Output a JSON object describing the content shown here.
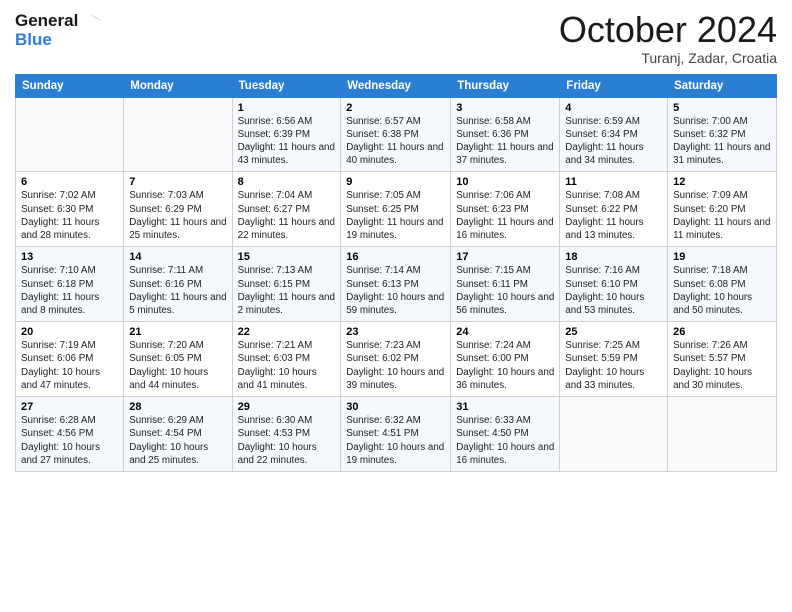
{
  "header": {
    "logo_line1": "General",
    "logo_line2": "Blue",
    "month": "October 2024",
    "location": "Turanj, Zadar, Croatia"
  },
  "days_of_week": [
    "Sunday",
    "Monday",
    "Tuesday",
    "Wednesday",
    "Thursday",
    "Friday",
    "Saturday"
  ],
  "weeks": [
    [
      {
        "day": "",
        "sunrise": "",
        "sunset": "",
        "daylight": ""
      },
      {
        "day": "",
        "sunrise": "",
        "sunset": "",
        "daylight": ""
      },
      {
        "day": "1",
        "sunrise": "Sunrise: 6:56 AM",
        "sunset": "Sunset: 6:39 PM",
        "daylight": "Daylight: 11 hours and 43 minutes."
      },
      {
        "day": "2",
        "sunrise": "Sunrise: 6:57 AM",
        "sunset": "Sunset: 6:38 PM",
        "daylight": "Daylight: 11 hours and 40 minutes."
      },
      {
        "day": "3",
        "sunrise": "Sunrise: 6:58 AM",
        "sunset": "Sunset: 6:36 PM",
        "daylight": "Daylight: 11 hours and 37 minutes."
      },
      {
        "day": "4",
        "sunrise": "Sunrise: 6:59 AM",
        "sunset": "Sunset: 6:34 PM",
        "daylight": "Daylight: 11 hours and 34 minutes."
      },
      {
        "day": "5",
        "sunrise": "Sunrise: 7:00 AM",
        "sunset": "Sunset: 6:32 PM",
        "daylight": "Daylight: 11 hours and 31 minutes."
      }
    ],
    [
      {
        "day": "6",
        "sunrise": "Sunrise: 7:02 AM",
        "sunset": "Sunset: 6:30 PM",
        "daylight": "Daylight: 11 hours and 28 minutes."
      },
      {
        "day": "7",
        "sunrise": "Sunrise: 7:03 AM",
        "sunset": "Sunset: 6:29 PM",
        "daylight": "Daylight: 11 hours and 25 minutes."
      },
      {
        "day": "8",
        "sunrise": "Sunrise: 7:04 AM",
        "sunset": "Sunset: 6:27 PM",
        "daylight": "Daylight: 11 hours and 22 minutes."
      },
      {
        "day": "9",
        "sunrise": "Sunrise: 7:05 AM",
        "sunset": "Sunset: 6:25 PM",
        "daylight": "Daylight: 11 hours and 19 minutes."
      },
      {
        "day": "10",
        "sunrise": "Sunrise: 7:06 AM",
        "sunset": "Sunset: 6:23 PM",
        "daylight": "Daylight: 11 hours and 16 minutes."
      },
      {
        "day": "11",
        "sunrise": "Sunrise: 7:08 AM",
        "sunset": "Sunset: 6:22 PM",
        "daylight": "Daylight: 11 hours and 13 minutes."
      },
      {
        "day": "12",
        "sunrise": "Sunrise: 7:09 AM",
        "sunset": "Sunset: 6:20 PM",
        "daylight": "Daylight: 11 hours and 11 minutes."
      }
    ],
    [
      {
        "day": "13",
        "sunrise": "Sunrise: 7:10 AM",
        "sunset": "Sunset: 6:18 PM",
        "daylight": "Daylight: 11 hours and 8 minutes."
      },
      {
        "day": "14",
        "sunrise": "Sunrise: 7:11 AM",
        "sunset": "Sunset: 6:16 PM",
        "daylight": "Daylight: 11 hours and 5 minutes."
      },
      {
        "day": "15",
        "sunrise": "Sunrise: 7:13 AM",
        "sunset": "Sunset: 6:15 PM",
        "daylight": "Daylight: 11 hours and 2 minutes."
      },
      {
        "day": "16",
        "sunrise": "Sunrise: 7:14 AM",
        "sunset": "Sunset: 6:13 PM",
        "daylight": "Daylight: 10 hours and 59 minutes."
      },
      {
        "day": "17",
        "sunrise": "Sunrise: 7:15 AM",
        "sunset": "Sunset: 6:11 PM",
        "daylight": "Daylight: 10 hours and 56 minutes."
      },
      {
        "day": "18",
        "sunrise": "Sunrise: 7:16 AM",
        "sunset": "Sunset: 6:10 PM",
        "daylight": "Daylight: 10 hours and 53 minutes."
      },
      {
        "day": "19",
        "sunrise": "Sunrise: 7:18 AM",
        "sunset": "Sunset: 6:08 PM",
        "daylight": "Daylight: 10 hours and 50 minutes."
      }
    ],
    [
      {
        "day": "20",
        "sunrise": "Sunrise: 7:19 AM",
        "sunset": "Sunset: 6:06 PM",
        "daylight": "Daylight: 10 hours and 47 minutes."
      },
      {
        "day": "21",
        "sunrise": "Sunrise: 7:20 AM",
        "sunset": "Sunset: 6:05 PM",
        "daylight": "Daylight: 10 hours and 44 minutes."
      },
      {
        "day": "22",
        "sunrise": "Sunrise: 7:21 AM",
        "sunset": "Sunset: 6:03 PM",
        "daylight": "Daylight: 10 hours and 41 minutes."
      },
      {
        "day": "23",
        "sunrise": "Sunrise: 7:23 AM",
        "sunset": "Sunset: 6:02 PM",
        "daylight": "Daylight: 10 hours and 39 minutes."
      },
      {
        "day": "24",
        "sunrise": "Sunrise: 7:24 AM",
        "sunset": "Sunset: 6:00 PM",
        "daylight": "Daylight: 10 hours and 36 minutes."
      },
      {
        "day": "25",
        "sunrise": "Sunrise: 7:25 AM",
        "sunset": "Sunset: 5:59 PM",
        "daylight": "Daylight: 10 hours and 33 minutes."
      },
      {
        "day": "26",
        "sunrise": "Sunrise: 7:26 AM",
        "sunset": "Sunset: 5:57 PM",
        "daylight": "Daylight: 10 hours and 30 minutes."
      }
    ],
    [
      {
        "day": "27",
        "sunrise": "Sunrise: 6:28 AM",
        "sunset": "Sunset: 4:56 PM",
        "daylight": "Daylight: 10 hours and 27 minutes."
      },
      {
        "day": "28",
        "sunrise": "Sunrise: 6:29 AM",
        "sunset": "Sunset: 4:54 PM",
        "daylight": "Daylight: 10 hours and 25 minutes."
      },
      {
        "day": "29",
        "sunrise": "Sunrise: 6:30 AM",
        "sunset": "Sunset: 4:53 PM",
        "daylight": "Daylight: 10 hours and 22 minutes."
      },
      {
        "day": "30",
        "sunrise": "Sunrise: 6:32 AM",
        "sunset": "Sunset: 4:51 PM",
        "daylight": "Daylight: 10 hours and 19 minutes."
      },
      {
        "day": "31",
        "sunrise": "Sunrise: 6:33 AM",
        "sunset": "Sunset: 4:50 PM",
        "daylight": "Daylight: 10 hours and 16 minutes."
      },
      {
        "day": "",
        "sunrise": "",
        "sunset": "",
        "daylight": ""
      },
      {
        "day": "",
        "sunrise": "",
        "sunset": "",
        "daylight": ""
      }
    ]
  ]
}
